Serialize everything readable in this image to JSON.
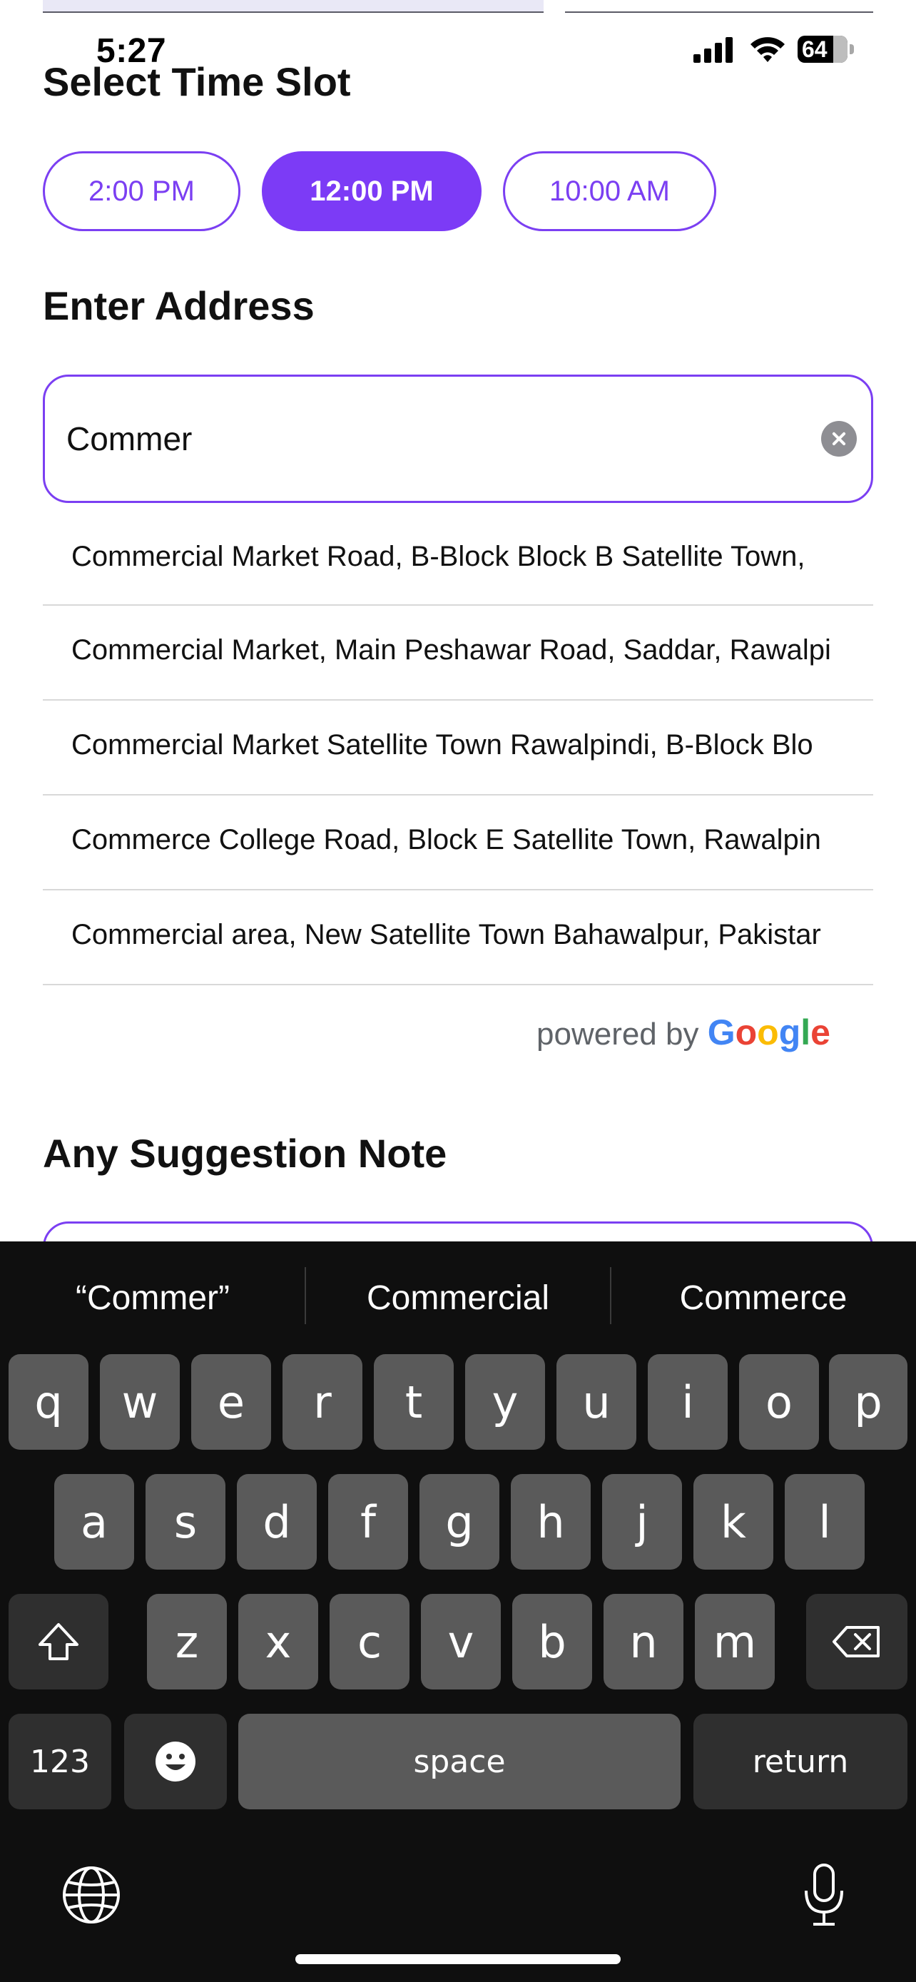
{
  "status_bar": {
    "time": "5:27",
    "battery": "64"
  },
  "time_slot": {
    "title": "Select Time Slot",
    "slots": [
      {
        "label": "2:00 PM",
        "selected": false
      },
      {
        "label": "12:00 PM",
        "selected": true
      },
      {
        "label": "10:00 AM",
        "selected": false
      }
    ]
  },
  "address": {
    "title": "Enter Address",
    "input_value": "Commer",
    "suggestions": [
      "Commercial Market Road, B-Block Block B Satellite Town,",
      "Commercial Market, Main Peshawar Road, Saddar, Rawalpi",
      "Commercial Market Satellite Town Rawalpindi, B-Block Blo",
      "Commerce College Road, Block E Satellite Town, Rawalpin",
      "Commercial area, New Satellite Town Bahawalpur, Pakistar"
    ],
    "powered_by": "powered by",
    "google": [
      "G",
      "o",
      "o",
      "g",
      "l",
      "e"
    ]
  },
  "note": {
    "title": "Any Suggestion Note"
  },
  "keyboard": {
    "predictions": [
      "“Commer”",
      "Commercial",
      "Commerce"
    ],
    "row1": [
      "q",
      "w",
      "e",
      "r",
      "t",
      "y",
      "u",
      "i",
      "o",
      "p"
    ],
    "row2": [
      "a",
      "s",
      "d",
      "f",
      "g",
      "h",
      "j",
      "k",
      "l"
    ],
    "row3": [
      "z",
      "x",
      "c",
      "v",
      "b",
      "n",
      "m"
    ],
    "numbers_key": "123",
    "space_key": "space",
    "return_key": "return"
  },
  "colors": {
    "accent": "#7c3bf6",
    "keyboard_bg": "#0f0f0f",
    "key": "#5a5a5a",
    "key_dark": "#2f2f2f"
  }
}
